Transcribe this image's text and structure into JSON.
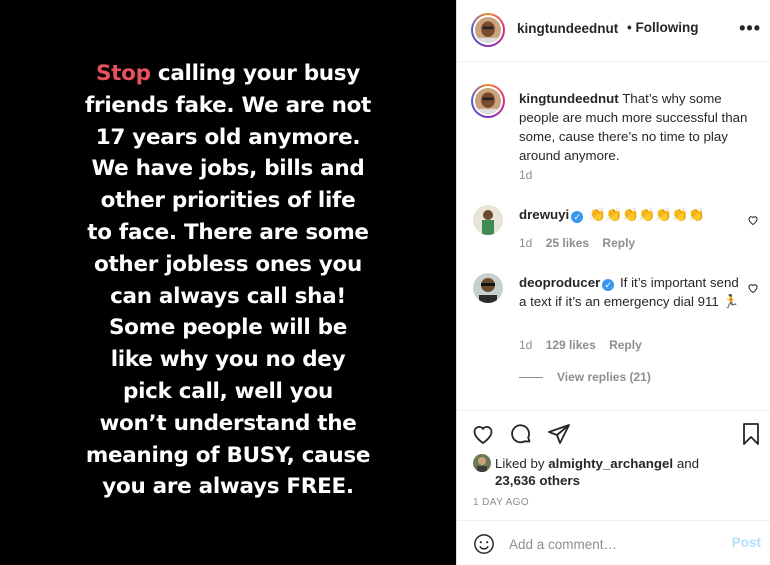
{
  "image": {
    "highlight": "Stop",
    "lines": [
      " calling your busy",
      "friends fake. We are not",
      "17 years old anymore.",
      "We have jobs, bills and",
      "other priorities of life",
      "to face. There are some",
      "other jobless ones you",
      "can always call sha!",
      "Some people will be",
      "like why you no dey",
      "pick call, well you",
      "won’t understand the",
      "meaning of BUSY, cause",
      "you are always FREE."
    ]
  },
  "header": {
    "username": "kingtundeednut",
    "follow_status": "• Following",
    "more": "•••"
  },
  "caption": {
    "username": "kingtundeednut",
    "text": "That’s why some people are much more successful than some, cause there’s no time to play around anymore.",
    "time": "1d"
  },
  "comments": [
    {
      "username": "drewuyi",
      "verified": true,
      "text": "👏👏👏👏👏👏👏",
      "time": "1d",
      "likes": "25 likes",
      "reply": "Reply"
    },
    {
      "username": "deoproducer",
      "verified": true,
      "text": "If it’s important send a text if it’s an emergency dial 911 🏃",
      "time": "1d",
      "likes": "129 likes",
      "reply": "Reply"
    }
  ],
  "view_replies": "View replies (21)",
  "likes": {
    "prefix": "Liked by",
    "user": "almighty_archangel",
    "and": "and",
    "count": "23,636 others"
  },
  "post_date": "1 DAY AGO",
  "add_comment": {
    "placeholder": "Add a comment…",
    "post_label": "Post"
  },
  "colors": {
    "highlight_red": "#e8505b",
    "verified_blue": "#3897f0",
    "post_disabled": "#b2dffc"
  }
}
